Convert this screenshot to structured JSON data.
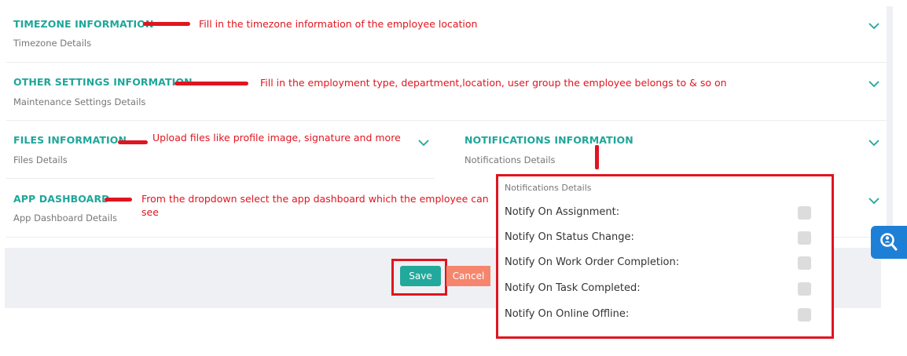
{
  "sections": {
    "timezone": {
      "title": "TIMEZONE INFORMATION",
      "subtitle": "Timezone Details"
    },
    "other_settings": {
      "title": "OTHER SETTINGS INFORMATION",
      "subtitle": "Maintenance Settings Details"
    },
    "files": {
      "title": "FILES INFORMATION",
      "subtitle": "Files Details"
    },
    "notifications": {
      "title": "NOTIFICATIONS INFORMATION",
      "subtitle": "Notifications Details"
    },
    "app_dashboard": {
      "title": "APP DASHBOARD",
      "subtitle": "App Dashboard Details"
    }
  },
  "annotations": {
    "timezone": "Fill in the timezone information of the employee location",
    "other_settings": "Fill in the employment type, department,location, user group the employee belongs to & so on",
    "files": "Upload files like profile image, signature and more",
    "app_dashboard": "From the dropdown select the app dashboard which the employee can see"
  },
  "notifications_panel": {
    "header": "Notifications Details",
    "items": [
      {
        "label": "Notify On Assignment:",
        "checked": false
      },
      {
        "label": "Notify On Status Change:",
        "checked": false
      },
      {
        "label": "Notify On Work Order Completion:",
        "checked": false
      },
      {
        "label": "Notify On Task Completed:",
        "checked": false
      },
      {
        "label": "Notify On Online Offline:",
        "checked": false
      }
    ]
  },
  "buttons": {
    "save": "Save",
    "cancel": "Cancel"
  },
  "icons": {
    "expand": "chevron-down-icon",
    "search_help": "search-help-icon"
  },
  "colors": {
    "accent": "#1fa69a",
    "save": "#23a99c",
    "cancel": "#f5866d",
    "annotation": "#e0151f",
    "fab": "#1e7fd6"
  }
}
